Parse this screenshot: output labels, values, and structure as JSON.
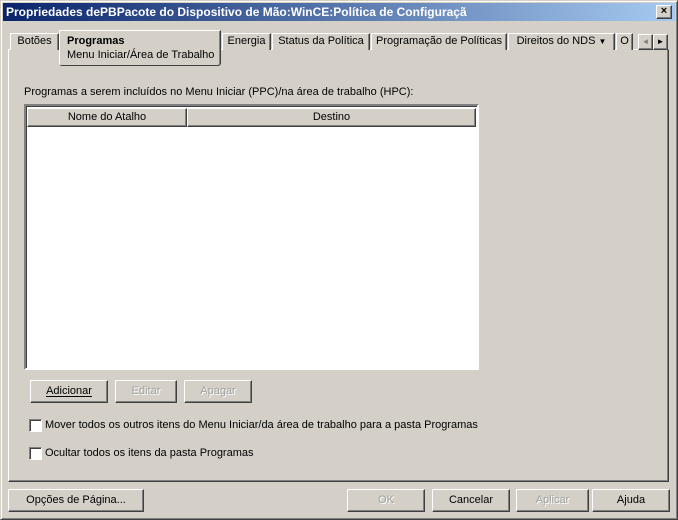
{
  "window": {
    "title": "Propriedades dePBPacote do Dispositivo de Mão:WinCE:Política de Configuraçã",
    "close_label": "×"
  },
  "tabs": [
    {
      "label": "Botões"
    },
    {
      "label": "Programas",
      "sublabel": "Menu Iniciar/Área de Trabalho",
      "active": true
    },
    {
      "label": "Energia"
    },
    {
      "label": "Status da Política"
    },
    {
      "label": "Programação de Políticas"
    },
    {
      "label": "Direitos do NDS",
      "dropdown": true
    },
    {
      "label": "O"
    }
  ],
  "tab_scroll": {
    "left": "◄",
    "right": "►"
  },
  "main": {
    "list_label": "Programas a serem incluídos no Menu Iniciar (PPC)/na área de trabalho (HPC):",
    "columns": [
      "Nome do Atalho",
      "Destino"
    ],
    "rows": [],
    "buttons": {
      "add": "Adicionar",
      "edit": "Editar",
      "delete": "Apagar"
    },
    "checkboxes": [
      {
        "label": "Mover todos os outros itens do Menu Iniciar/da área de trabalho para a pasta Programas",
        "checked": false
      },
      {
        "label": "Ocultar todos os itens da pasta Programas",
        "checked": false
      }
    ]
  },
  "footer": {
    "page_options": "Opções de Página...",
    "ok": "OK",
    "cancel": "Cancelar",
    "apply": "Aplicar",
    "help": "Ajuda"
  }
}
